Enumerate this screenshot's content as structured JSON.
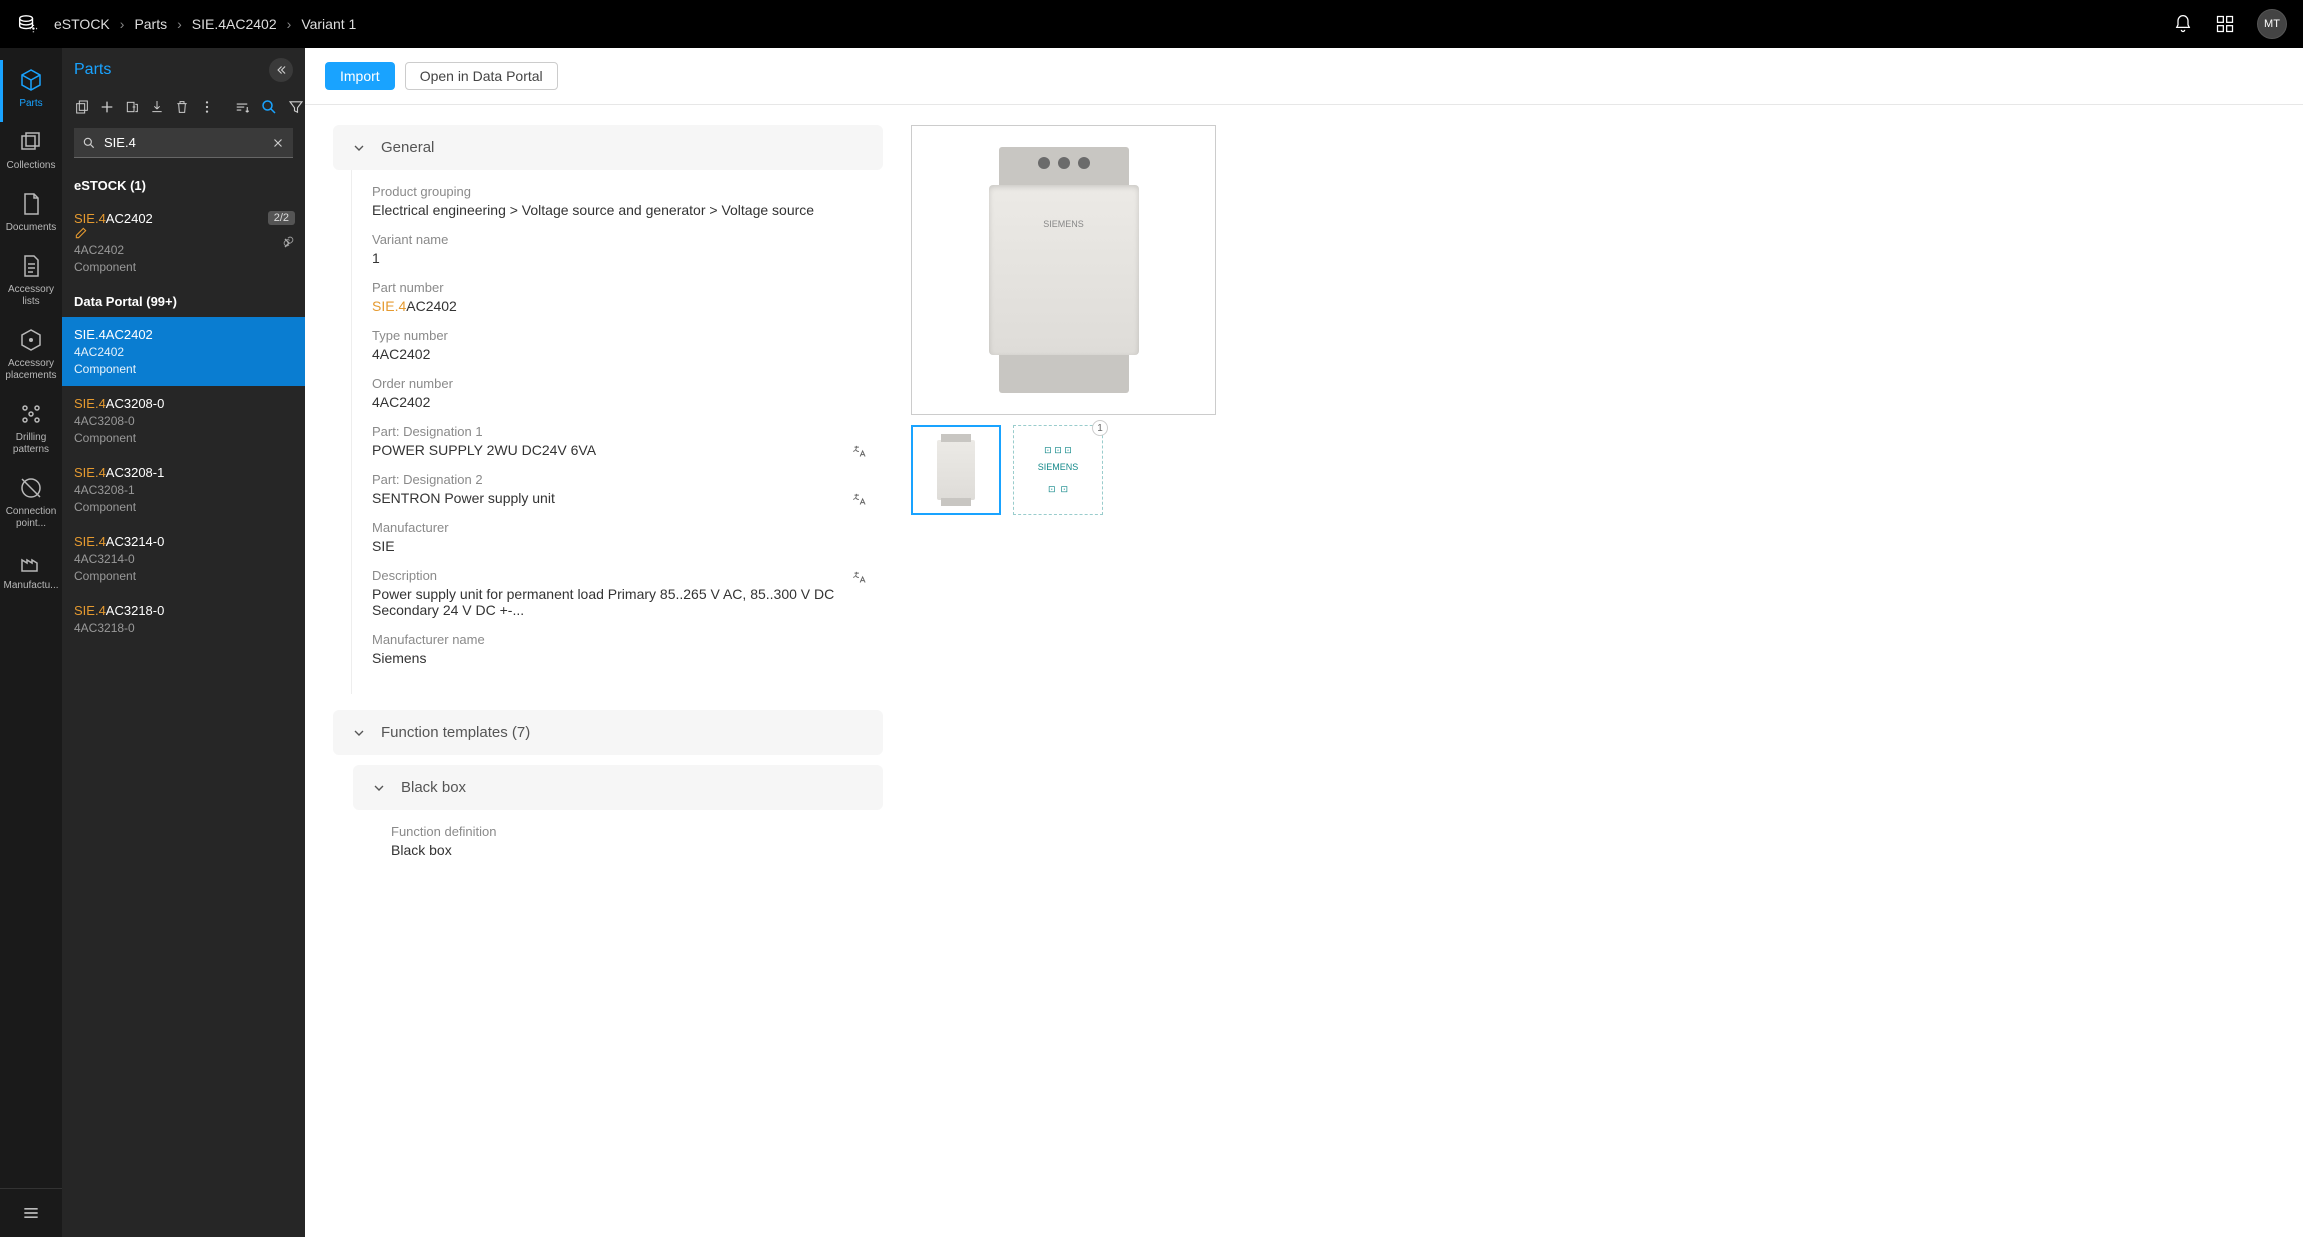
{
  "topbar": {
    "breadcrumb": [
      "eSTOCK",
      "Parts",
      "SIE.4AC2402",
      "Variant 1"
    ],
    "avatar": "MT"
  },
  "rail": {
    "items": [
      {
        "label": "Parts",
        "active": true
      },
      {
        "label": "Collections"
      },
      {
        "label": "Documents"
      },
      {
        "label": "Accessory lists"
      },
      {
        "label": "Accessory placements"
      },
      {
        "label": "Drilling patterns"
      },
      {
        "label": "Connection point..."
      },
      {
        "label": "Manufactu..."
      }
    ]
  },
  "panel": {
    "title": "Parts",
    "search_value": "SIE.4",
    "group_local": "eSTOCK (1)",
    "local_items": [
      {
        "title_prefix": "SIE.4",
        "title_rest": "AC2402",
        "sub": "4AC2402",
        "type": "Component",
        "badge": "2/2",
        "editable": true
      }
    ],
    "group_portal": "Data Portal (99+)",
    "portal_items": [
      {
        "title_prefix": "SIE.4",
        "title_rest": "AC2402",
        "sub": "4AC2402",
        "type": "Component",
        "selected": true
      },
      {
        "title_prefix": "SIE.4",
        "title_rest": "AC3208-0",
        "sub": "4AC3208-0",
        "type": "Component"
      },
      {
        "title_prefix": "SIE.4",
        "title_rest": "AC3208-1",
        "sub": "4AC3208-1",
        "type": "Component"
      },
      {
        "title_prefix": "SIE.4",
        "title_rest": "AC3214-0",
        "sub": "4AC3214-0",
        "type": "Component"
      },
      {
        "title_prefix": "SIE.4",
        "title_rest": "AC3218-0",
        "sub": "4AC3218-0",
        "type": ""
      }
    ]
  },
  "content": {
    "import_label": "Import",
    "open_portal_label": "Open in Data Portal",
    "sections": {
      "general": {
        "title": "General",
        "fields": {
          "product_grouping": {
            "label": "Product grouping",
            "value": "Electrical engineering > Voltage source and generator > Voltage source"
          },
          "variant_name": {
            "label": "Variant name",
            "value": "1"
          },
          "part_number": {
            "label": "Part number",
            "value_prefix": "SIE.4",
            "value_rest": "AC2402"
          },
          "type_number": {
            "label": "Type number",
            "value": "4AC2402"
          },
          "order_number": {
            "label": "Order number",
            "value": "4AC2402"
          },
          "designation1": {
            "label": "Part: Designation 1",
            "value": "POWER SUPPLY 2WU DC24V 6VA"
          },
          "designation2": {
            "label": "Part: Designation 2",
            "value": "SENTRON Power supply unit"
          },
          "manufacturer": {
            "label": "Manufacturer",
            "value": "SIE"
          },
          "description": {
            "label": "Description",
            "value": "Power supply unit for permanent load Primary 85..265 V AC, 85..300 V DC Secondary 24 V DC +-..."
          },
          "manufacturer_name": {
            "label": "Manufacturer name",
            "value": "Siemens"
          }
        }
      },
      "function_templates": {
        "title": "Function templates (7)",
        "blackbox": {
          "title": "Black box",
          "fields": {
            "function_definition": {
              "label": "Function definition",
              "value": "Black box"
            }
          }
        }
      }
    },
    "image": {
      "brand_text": "SIEMENS",
      "thumb2_label": "SIEMENS",
      "thumb2_badge": "1"
    }
  }
}
